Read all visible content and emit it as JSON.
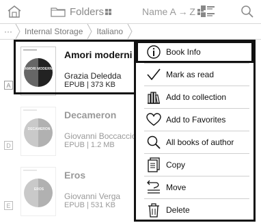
{
  "toolbar": {
    "icons": [
      "home-icon",
      "folder-icon",
      "grid-icon",
      "list-view-icon",
      "search-icon"
    ],
    "folders_label": "Folders",
    "sort_label": "Name A → Z"
  },
  "breadcrumb": {
    "dots": "···",
    "parts": [
      "Internal Storage",
      "Italiano"
    ]
  },
  "books": [
    {
      "letter": "A",
      "title": "Amori moderni",
      "author": "Grazia Deledda",
      "meta": "EPUB | 373 KB",
      "cover_title": "AMORI MODERNI"
    },
    {
      "letter": "D",
      "title": "Decameron",
      "author": "Giovanni Boccaccio",
      "meta": "EPUB | 1.2 MB",
      "cover_title": "DECAMERON"
    },
    {
      "letter": "E",
      "title": "Eros",
      "author": "Giovanni Verga",
      "meta": "EPUB | 531 KB",
      "cover_title": "EROS"
    }
  ],
  "menu": {
    "items": [
      {
        "label": "Book Info",
        "icon": "info-icon"
      },
      {
        "label": "Mark as read",
        "icon": "checkmark-icon"
      },
      {
        "label": "Add to collection",
        "icon": "collection-icon"
      },
      {
        "label": "Add to Favorites",
        "icon": "heart-icon"
      },
      {
        "label": "All books of author",
        "icon": "search-icon"
      },
      {
        "label": "Copy",
        "icon": "copy-icon"
      },
      {
        "label": "Move",
        "icon": "move-icon"
      },
      {
        "label": "Delete",
        "icon": "trash-icon"
      }
    ]
  }
}
